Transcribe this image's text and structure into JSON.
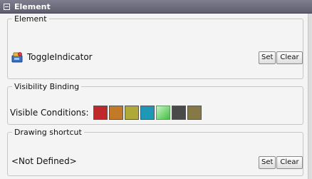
{
  "header": {
    "title": "Element"
  },
  "element_group": {
    "legend": "Element",
    "name": "ToggleIndicator",
    "set_label": "Set",
    "clear_label": "Clear"
  },
  "visibility_group": {
    "legend": "Visibility Binding",
    "label": "Visible Conditions:",
    "swatches": [
      "#c1262b",
      "#c37a28",
      "#b0a839",
      "#1f97b7",
      "#5ec85e",
      "#4a4a4a",
      "#857a45"
    ]
  },
  "drawing_group": {
    "legend": "Drawing shortcut",
    "value": "<Not Defined>",
    "set_label": "Set",
    "clear_label": "Clear"
  }
}
